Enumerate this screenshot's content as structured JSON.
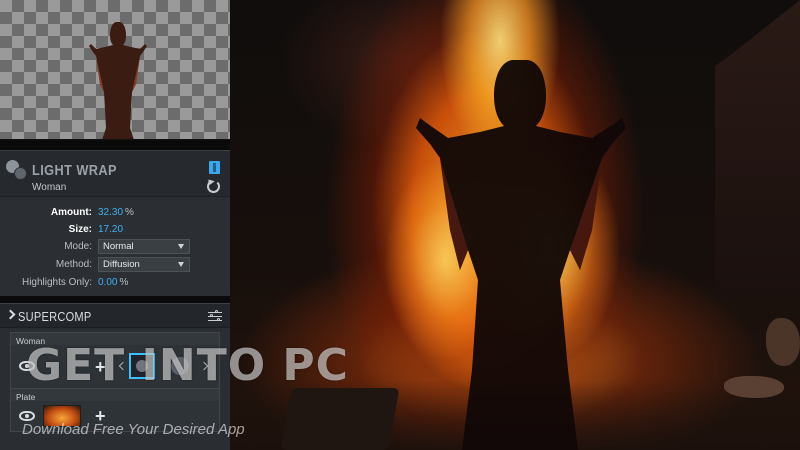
{
  "light_wrap": {
    "title": "LIGHT WRAP",
    "subtitle": "Woman",
    "params": [
      {
        "label": "Amount:",
        "value": "32.30",
        "unit": "%"
      },
      {
        "label": "Size:",
        "value": "17.20",
        "unit": ""
      },
      {
        "label": "Mode:",
        "select": "Normal"
      },
      {
        "label": "Method:",
        "select": "Diffusion"
      },
      {
        "label": "Highlights Only:",
        "value": "0.00",
        "unit": "%"
      }
    ]
  },
  "supercomp": {
    "title": "SUPERCOMP",
    "layers": [
      {
        "name": "Woman"
      },
      {
        "name": "Plate"
      }
    ]
  },
  "watermark": {
    "main": "GET INTO PC",
    "sub": "Download Free Your Desired App"
  },
  "colors": {
    "accent": "#3fb0f0",
    "node_outline": "#39c2ff",
    "panel_bg": "#2b2f33"
  },
  "icons": [
    "light-wrap-logo-icon",
    "toggle-icon",
    "reset-icon",
    "chevron-right-icon",
    "settings-sliders-icon",
    "eye-icon",
    "plus-icon"
  ]
}
